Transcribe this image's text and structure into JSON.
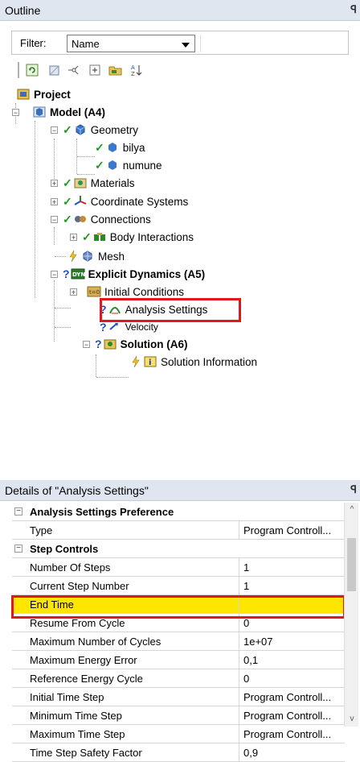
{
  "outline": {
    "title": "Outline",
    "pin_glyph": "ꟼ",
    "filter_label": "Filter:",
    "filter_value": "Name"
  },
  "tree": {
    "project": "Project",
    "model": "Model (A4)",
    "geometry": "Geometry",
    "bilya": "bilya",
    "numune": "numune",
    "materials": "Materials",
    "coordinate_systems": "Coordinate Systems",
    "connections": "Connections",
    "body_interactions": "Body Interactions",
    "mesh": "Mesh",
    "explicit_dynamics": "Explicit Dynamics (A5)",
    "initial_conditions": "Initial Conditions",
    "analysis_settings": "Analysis Settings",
    "velocity": "Velocity",
    "solution": "Solution (A6)",
    "solution_information": "Solution Information"
  },
  "details": {
    "title": "Details of \"Analysis Settings\"",
    "rows": [
      {
        "key": "Analysis Settings Preference",
        "value": "",
        "group": true
      },
      {
        "key": "Type",
        "value": "Program Controll..."
      },
      {
        "key": "Step Controls",
        "value": "",
        "group": true
      },
      {
        "key": "Number Of Steps",
        "value": "1"
      },
      {
        "key": "Current Step Number",
        "value": "1"
      },
      {
        "key": "End Time",
        "value": ""
      },
      {
        "key": "Resume From Cycle",
        "value": "0"
      },
      {
        "key": "Maximum Number of Cycles",
        "value": "1e+07"
      },
      {
        "key": "Maximum Energy Error",
        "value": "0,1"
      },
      {
        "key": "Reference Energy Cycle",
        "value": "0"
      },
      {
        "key": "Initial Time Step",
        "value": "Program Controll..."
      },
      {
        "key": "Minimum Time Step",
        "value": "Program Controll..."
      },
      {
        "key": "Maximum Time Step",
        "value": "Program Controll..."
      },
      {
        "key": "Time Step Safety Factor",
        "value": "0,9"
      }
    ]
  },
  "colors": {
    "highlight_row": "#ffe600",
    "red_box": "#e01818",
    "header_bg": "#dfe6f0"
  }
}
